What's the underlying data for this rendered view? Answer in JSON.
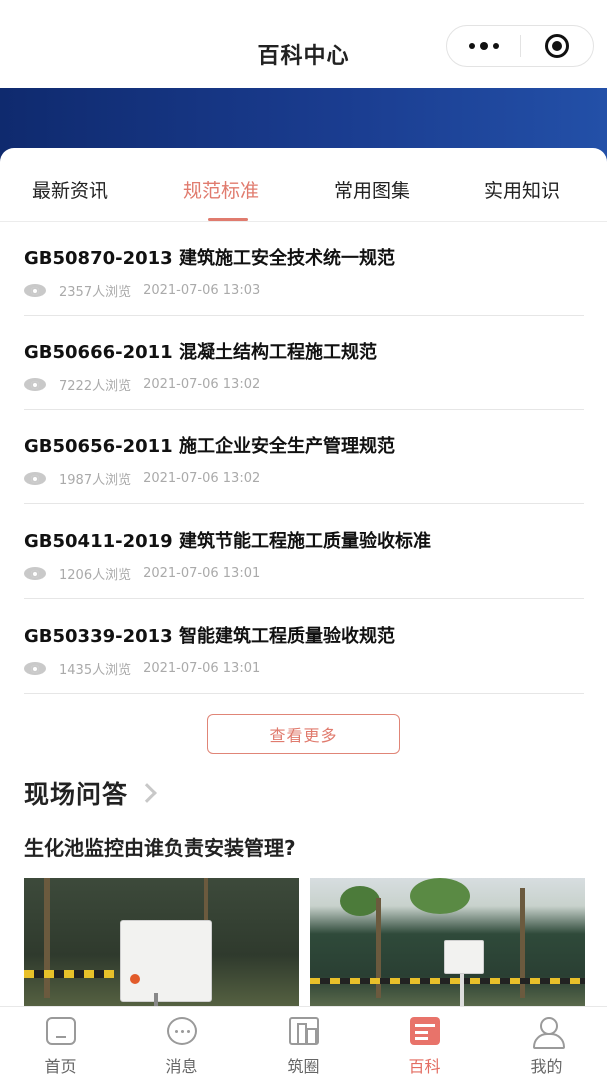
{
  "navbar": {
    "title": "百科中心"
  },
  "tabs": [
    {
      "label": "最新资讯",
      "active": false
    },
    {
      "label": "规范标准",
      "active": true
    },
    {
      "label": "常用图集",
      "active": false
    },
    {
      "label": "实用知识",
      "active": false
    }
  ],
  "articles": [
    {
      "title": "GB50870-2013 建筑施工安全技术统一规范",
      "views": "2357人浏览",
      "time": "2021-07-06 13:03"
    },
    {
      "title": "GB50666-2011 混凝土结构工程施工规范",
      "views": "7222人浏览",
      "time": "2021-07-06 13:02"
    },
    {
      "title": "GB50656-2011 施工企业安全生产管理规范",
      "views": "1987人浏览",
      "time": "2021-07-06 13:02"
    },
    {
      "title": "GB50411-2019 建筑节能工程施工质量验收标准",
      "views": "1206人浏览",
      "time": "2021-07-06 13:01"
    },
    {
      "title": "GB50339-2013 智能建筑工程质量验收规范",
      "views": "1435人浏览",
      "time": "2021-07-06 13:01"
    }
  ],
  "more_button": "查看更多",
  "qa": {
    "heading": "现场问答",
    "question": "生化池监控由谁负责安装管理?"
  },
  "tabbar": [
    {
      "label": "首页",
      "icon": "home-icon",
      "active": false
    },
    {
      "label": "消息",
      "icon": "message-icon",
      "active": false
    },
    {
      "label": "筑圈",
      "icon": "building-icon",
      "active": false
    },
    {
      "label": "百科",
      "icon": "encyclopedia-icon",
      "active": true
    },
    {
      "label": "我的",
      "icon": "profile-icon",
      "active": false
    }
  ],
  "colors": {
    "accent": "#e07b6e",
    "banner": "#1a3c8f"
  }
}
